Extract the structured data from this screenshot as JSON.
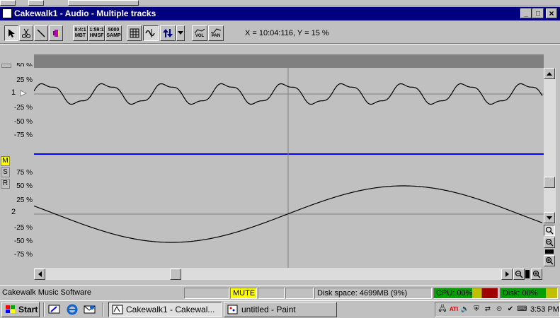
{
  "window": {
    "title": "Cakewalk1 - Audio - Multiple tracks",
    "controls": {
      "minimize": "_",
      "maximize": "□",
      "close": "×"
    }
  },
  "toolbar": {
    "cursor_readout": "X = 10:04:116, Y = 15 %",
    "time_format_mbt": "8:4:1 MBT",
    "time_format_hmsf": "1:59:1 HMSF",
    "time_format_samp": "5000 SAMP",
    "vol_label": "VOL",
    "pan_label": "PAN"
  },
  "tracks": [
    {
      "number": "1",
      "y_labels": [
        "50 %",
        "25 %",
        "-25 %",
        "-50 %",
        "-75 %"
      ],
      "waveform": "audio-track-1"
    },
    {
      "number": "2",
      "buttons": {
        "mute": "M",
        "solo": "S",
        "record": "R"
      },
      "y_labels": [
        "75 %",
        "50 %",
        "25 %",
        "-25 %",
        "-50 %",
        "-75 %"
      ],
      "waveform": "audio-track-2"
    }
  ],
  "status_bar": {
    "app_name": "Cakewalk Music Software",
    "mute": "MUTE",
    "disk_space": "Disk space: 4699MB (9%)",
    "cpu": "CPU: 00%",
    "disk": "Disk: 00%"
  },
  "taskbar": {
    "start": "Start",
    "tasks": [
      {
        "label": "Cakewalk1 - Cakewal...",
        "active": true
      },
      {
        "label": "untitled - Paint",
        "active": false
      }
    ],
    "clock": "3:53 PM"
  },
  "colors": {
    "title_bar": "#000080",
    "track_bg": "#c0c0c0",
    "header_strip": "#808080",
    "separator": "#0000ff",
    "mute_bg": "#ffff00",
    "cpu_meter": "#00a000",
    "disk_meter": "#00a000"
  }
}
